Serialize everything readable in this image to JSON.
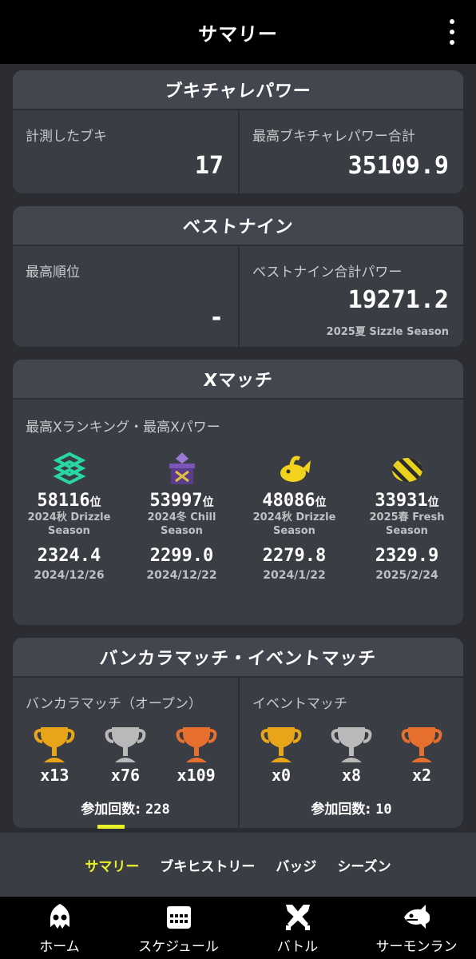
{
  "header": {
    "title": "サマリー"
  },
  "weapon_power": {
    "title": "ブキチャレパワー",
    "measured_label": "計測したブキ",
    "measured_value": "17",
    "max_label": "最高ブキチャレパワー合計",
    "max_value": "35109.9"
  },
  "best_nine": {
    "title": "ベストナイン",
    "rank_label": "最高順位",
    "rank_value": "-",
    "power_label": "ベストナイン合計パワー",
    "power_value": "19271.2",
    "power_season": "2025夏 Sizzle Season"
  },
  "x_match": {
    "title": "Xマッチ",
    "subtitle": "最高Xランキング・最高Xパワー",
    "rank_suffix": "位",
    "columns": [
      {
        "icon": "splat-zones-icon",
        "rank": "58116",
        "season": "2024秋 Drizzle Season",
        "power": "2324.4",
        "date": "2024/12/26"
      },
      {
        "icon": "tower-control-icon",
        "rank": "53997",
        "season": "2024冬 Chill Season",
        "power": "2299.0",
        "date": "2024/12/22"
      },
      {
        "icon": "rainmaker-icon",
        "rank": "48086",
        "season": "2024秋 Drizzle Season",
        "power": "2279.8",
        "date": "2024/1/22"
      },
      {
        "icon": "clam-blitz-icon",
        "rank": "33931",
        "season": "2025春 Fresh Season",
        "power": "2329.9",
        "date": "2025/2/24"
      }
    ]
  },
  "anarchy_event": {
    "title": "バンカラマッチ・イベントマッチ",
    "anarchy": {
      "label": "バンカラマッチ（オープン）",
      "gold": "x13",
      "silver": "x76",
      "bronze": "x109",
      "participation_label": "参加回数:",
      "participation_value": "228"
    },
    "event": {
      "label": "イベントマッチ",
      "gold": "x0",
      "silver": "x8",
      "bronze": "x2",
      "participation_label": "参加回数:",
      "participation_value": "10"
    }
  },
  "subtabs": [
    "サマリー",
    "ブキヒストリー",
    "バッジ",
    "シーズン"
  ],
  "bottom_nav": [
    "ホーム",
    "スケジュール",
    "バトル",
    "サーモンラン"
  ],
  "colors": {
    "accent_yellow": "#e8f02a",
    "gold": "#e8a51a",
    "silver": "#b9b9b9",
    "bronze": "#e8702e"
  }
}
